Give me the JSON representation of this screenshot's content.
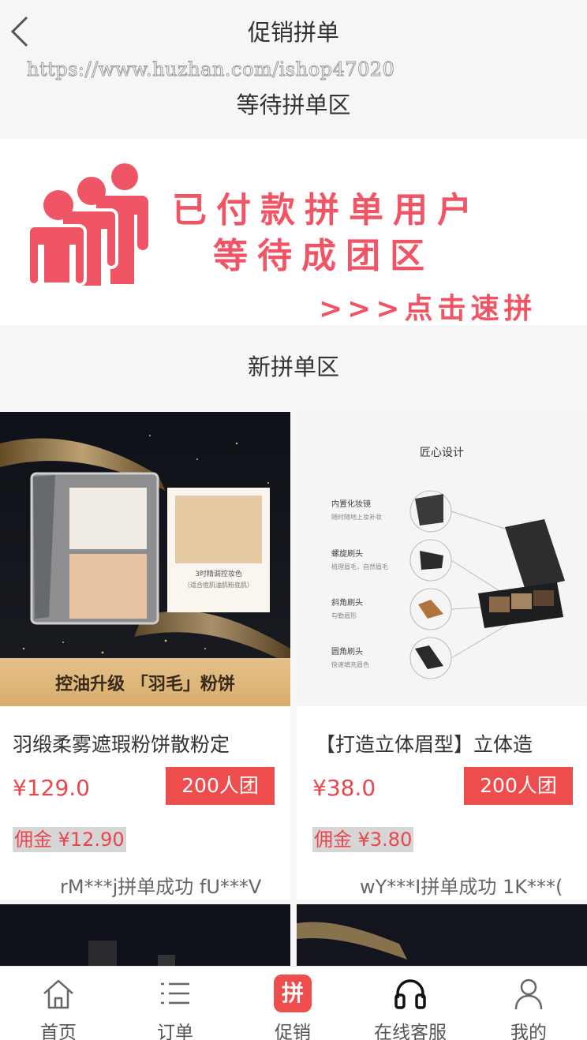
{
  "header": {
    "title": "促销拼单",
    "watermark": "https://www.huzhan.com/ishop47020"
  },
  "sections": {
    "waiting_title": "等待拼单区",
    "new_title": "新拼单区"
  },
  "banner": {
    "line1": "已付款拼单用户",
    "line2": "等待成团区",
    "cta": ">>>点击速拼",
    "accent_color": "#f05566"
  },
  "products": [
    {
      "name": "羽缎柔雾遮瑕粉饼散粉定",
      "price": "¥129.0",
      "group_label": "200人团",
      "commission": "佣金 ¥12.90",
      "ticker": "rM***j拼单成功 fU***V",
      "image": {
        "caption": "控油升级 「羽毛」粉饼",
        "card_text_1": "3时精调控妆色",
        "card_text_2": "（适合痘肌油肌粉底肌）"
      }
    },
    {
      "name": "【打造立体眉型】立体造",
      "price": "¥38.0",
      "group_label": "200人团",
      "commission": "佣金 ¥3.80",
      "ticker": "wY***I拼单成功 1K***(",
      "image": {
        "title": "匠心设计",
        "features": [
          {
            "label": "内置化妆镜",
            "sub": "随时随地上妆补妆"
          },
          {
            "label": "螺旋刷头",
            "sub": "梳理眉毛，自然眉毛"
          },
          {
            "label": "斜角刷头",
            "sub": "勾勒眉形"
          },
          {
            "label": "圆角刷头",
            "sub": "快速填充眉色"
          }
        ]
      }
    }
  ],
  "tabbar": {
    "items": [
      {
        "label": "首页",
        "icon": "home-icon"
      },
      {
        "label": "订单",
        "icon": "list-icon"
      },
      {
        "label": "促销",
        "icon": "pin-badge-icon",
        "badge_char": "拼",
        "badge_color": "#ee4d4d"
      },
      {
        "label": "在线客服",
        "icon": "headset-icon"
      },
      {
        "label": "我的",
        "icon": "user-icon"
      }
    ]
  },
  "colors": {
    "accent_red": "#ee4d4d",
    "price_red": "#e9464e"
  }
}
